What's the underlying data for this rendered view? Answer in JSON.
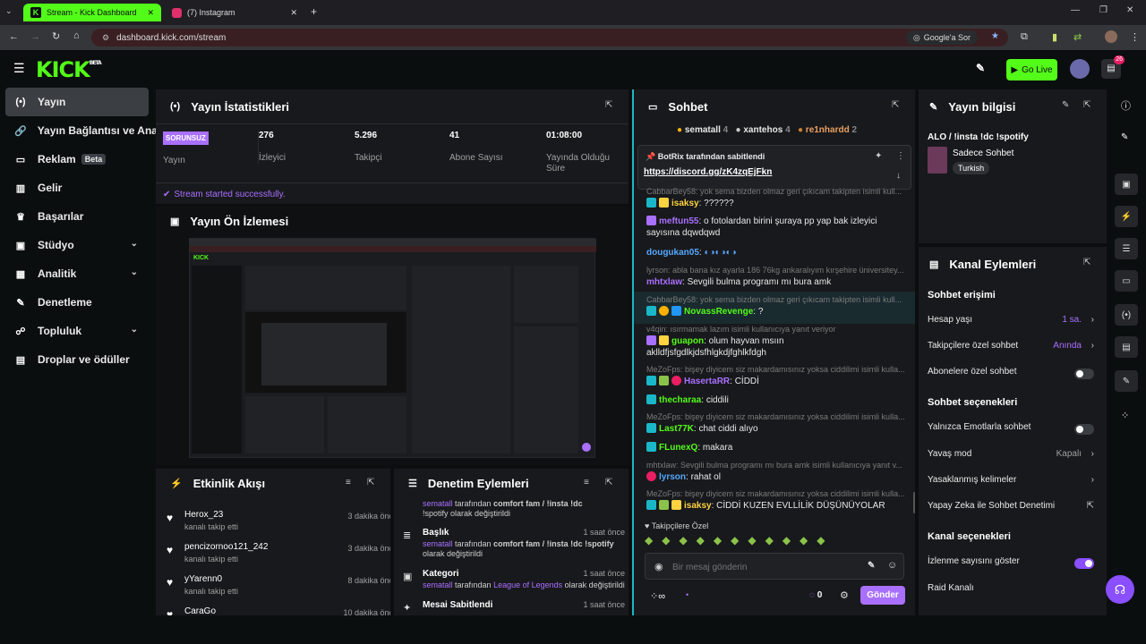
{
  "browser": {
    "tabs": [
      {
        "title": "Stream - Kick Dashboard",
        "active": true
      },
      {
        "title": "(7) Instagram",
        "active": false
      }
    ],
    "url": "dashboard.kick.com/stream",
    "google_lens": "Google'a Sor"
  },
  "header": {
    "logo": "KICK",
    "logo_badge": "BETA",
    "go_live": "Go Live",
    "notif_count": "26"
  },
  "nav": {
    "items": [
      {
        "label": "Yayın",
        "icon": "stream-icon"
      },
      {
        "label": "Yayın Bağlantısı ve Anahtarı",
        "icon": "link-icon"
      },
      {
        "label": "Reklam",
        "icon": "ad-icon",
        "badge": "Beta"
      },
      {
        "label": "Gelir",
        "icon": "revenue-icon"
      },
      {
        "label": "Başarılar",
        "icon": "trophy-icon"
      },
      {
        "label": "Stüdyo",
        "icon": "studio-icon"
      },
      {
        "label": "Analitik",
        "icon": "analytics-icon"
      },
      {
        "label": "Denetleme",
        "icon": "wrench-icon"
      },
      {
        "label": "Topluluk",
        "icon": "community-icon"
      },
      {
        "label": "Droplar ve ödüller",
        "icon": "drops-icon"
      }
    ]
  },
  "stats": {
    "title": "Yayın İstatistikleri",
    "status_badge": "SORUNSUZ",
    "items": [
      {
        "value": "",
        "label": "Yayın"
      },
      {
        "value": "276",
        "label": "İzleyici"
      },
      {
        "value": "5.296",
        "label": "Takipçi"
      },
      {
        "value": "41",
        "label": "Abone Sayısı"
      },
      {
        "value": "01:08:00",
        "label": "Yayında Olduğu Süre"
      }
    ],
    "success_msg": "Stream started successfully."
  },
  "preview": {
    "title": "Yayın Ön İzlemesi"
  },
  "events": {
    "title": "Etkinlik Akışı",
    "rows": [
      {
        "name": "Herox_23",
        "sub": "kanalı takip etti",
        "time": "3 dakika önce"
      },
      {
        "name": "pencizornoo121_242",
        "sub": "kanalı takip etti",
        "time": "3 dakika önce"
      },
      {
        "name": "yYarenn0",
        "sub": "kanalı takip etti",
        "time": "8 dakika önce"
      },
      {
        "name": "CaraGo",
        "sub": "",
        "time": "10 dakika önce"
      }
    ]
  },
  "mod": {
    "title": "Denetim Eylemleri",
    "top_text_a": "sematall",
    "top_text_b": "tarafından",
    "top_text_c": "comfort fam / !insta !dc",
    "top_text_d": "!spotify olarak değiştirildi",
    "rows": [
      {
        "title": "Başlık",
        "time": "1 saat önce",
        "user": "sematall",
        "mid": "tarafından",
        "value": "comfort fam / !insta !dc !spotify",
        "end": "olarak değiştirildi"
      },
      {
        "title": "Kategori",
        "time": "1 saat önce",
        "user": "sematall",
        "mid": "tarafından",
        "value": "League of Legends",
        "end": "olarak değiştirildi"
      },
      {
        "title": "Mesai Sabitlendi",
        "time": "1 saat önce",
        "user": "",
        "mid": "",
        "value": "",
        "end": ""
      }
    ]
  },
  "chat": {
    "title": "Sohbet",
    "top_gifters": [
      {
        "name": "sematall",
        "count": "4"
      },
      {
        "name": "xantehos",
        "count": "4"
      },
      {
        "name": "re1nhardd",
        "count": "2"
      }
    ],
    "pinned_by": "BotRix tarafından sabitlendi",
    "pinned_link": "https://discord.gg/zK4zqEjFkn",
    "messages": [
      {
        "sys": "CabbarBey58: yok sema bizden olmaz geri çıkıcam takipten isimli kull..."
      },
      {
        "user": "isaksy",
        "text": "??????",
        "color": "#ffd23f"
      },
      {
        "user": "meftun55",
        "text": "o fotolardan birini şuraya pp yap bak izleyici sayısına dqwdqwd",
        "color": "#a970ff"
      },
      {
        "user": "dougukan05",
        "text": "",
        "color": "#53a8ff"
      },
      {
        "sys": "lyrson: abla bana kız ayarla 186 76kg ankaralıyım kırşehire üniversitey..."
      },
      {
        "user": "mhtxlaw",
        "text": "Sevgili bulma programı mı bura amk",
        "color": "#a970ff"
      },
      {
        "sys": "CabbarBey58: yok sema bizden olmaz geri çıkıcam takipten isimli kull..."
      },
      {
        "user": "NovassRevenge",
        "text": "?",
        "color": "#53fc18"
      },
      {
        "sys": "v4qin: ısırmamak lazım isimli kullanıcıya yanıt veriyor"
      },
      {
        "user": "guapon",
        "text": "olum hayvan msıın aklldfjsfgdlkjdsfhlgkdjfghlkfdgh",
        "color": "#53fc18"
      },
      {
        "user": "HasertaRR",
        "text": "CİDDİ",
        "color": "#a970ff"
      },
      {
        "sys": "MeZoFps: bişey diyicem siz makardamısınız yoksa ciddilimi isimli kulla..."
      },
      {
        "user": "thecharaa",
        "text": "ciddili",
        "color": "#53fc18"
      },
      {
        "sys": "MeZoFps: bişey diyicem siz makardamısınız yoksa ciddilimi isimli kulla..."
      },
      {
        "user": "Last77K",
        "text": "chat ciddi alıyo",
        "color": "#53fc18"
      },
      {
        "user": "FLunexQ",
        "text": "makara",
        "color": "#53fc18"
      },
      {
        "sys": "mhtxlaw: Sevgili bulma programı mı bura amk isimli kullanıcıya yanıt v..."
      },
      {
        "user": "lyrson",
        "text": "rahat ol",
        "color": "#53a8ff"
      },
      {
        "sys": "MeZoFps: bişey diyicem siz makardamısınız yoksa ciddilimi isimli kulla..."
      },
      {
        "user": "isaksy",
        "text": "CİDDİ KUZEN EVLLİLİK DÜŞÜNÜYOLAR",
        "color": "#ffd23f"
      }
    ],
    "followers_only": "Takipçilere Özel",
    "input_placeholder": "Bir mesaj gönderin",
    "points": "0",
    "send": "Gönder"
  },
  "info": {
    "title": "Yayın bilgisi",
    "stream_title": "ALO / !insta !dc !spotify",
    "chat_mode": "Sadece Sohbet",
    "language": "Turkish"
  },
  "channel": {
    "title": "Kanal Eylemleri",
    "section1": "Sohbet erişimi",
    "account_age": "Hesap yaşı",
    "account_age_val": "1 sa.",
    "followers_chat": "Takipçilere özel sohbet",
    "followers_chat_val": "Anında",
    "subs_chat": "Abonelere özel sohbet",
    "section2": "Sohbet seçenekleri",
    "emotes_only": "Yalnızca Emotlarla sohbet",
    "slow_mode": "Yavaş mod",
    "slow_mode_val": "Kapalı",
    "banned_words": "Yasaklanmış kelimeler",
    "ai_mod": "Yapay Zeka ile Sohbet Denetimi",
    "section3": "Kanal seçenekleri",
    "viewer_count": "İzlenme sayısını göster",
    "raid": "Raid Kanalı"
  },
  "colors": {
    "accent": "#53fc18",
    "purple": "#a970ff",
    "panel": "#18191c"
  }
}
